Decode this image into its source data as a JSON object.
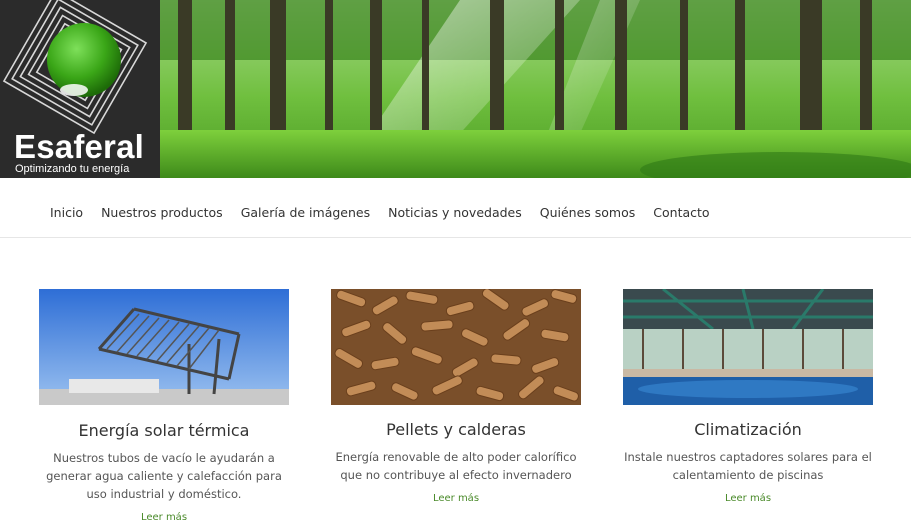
{
  "brand": {
    "name": "Esaferal",
    "tagline": "Optimizando tu energía",
    "logo_color": "#3aa617"
  },
  "nav": {
    "items": [
      {
        "label": "Inicio"
      },
      {
        "label": "Nuestros productos"
      },
      {
        "label": "Galería de imágenes"
      },
      {
        "label": "Noticias y novedades"
      },
      {
        "label": "Quiénes somos"
      },
      {
        "label": "Contacto"
      }
    ]
  },
  "cards": [
    {
      "title": "Energía solar térmica",
      "text": "Nuestros tubos de vacío le ayudarán a generar agua caliente y calefacción para uso industrial y doméstico.",
      "link": "Leer más"
    },
    {
      "title": "Pellets y calderas",
      "text": "Energía renovable de alto poder calorífico que no contribuye al efecto invernadero",
      "link": "Leer más"
    },
    {
      "title": "Climatización",
      "text": "Instale nuestros captadores solares para el calentamiento de piscinas",
      "link": "Leer más"
    }
  ],
  "colors": {
    "accent_link": "#4a8a2a",
    "header_dark": "#2b2b2b"
  }
}
